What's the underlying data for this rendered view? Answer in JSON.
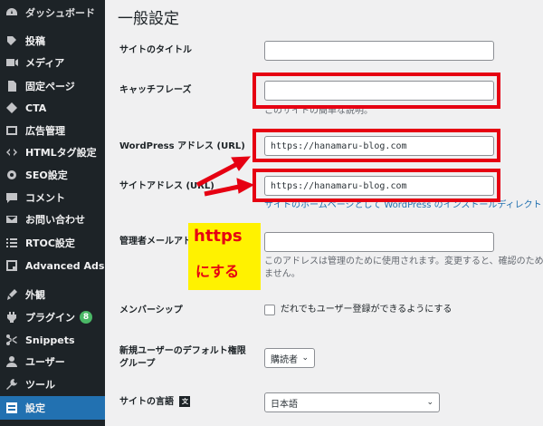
{
  "sidebar": {
    "items": [
      {
        "label": "ダッシュボード",
        "icon": "dashboard-icon"
      },
      {
        "label": "投稿",
        "icon": "pin-icon"
      },
      {
        "label": "メディア",
        "icon": "media-icon"
      },
      {
        "label": "固定ページ",
        "icon": "page-icon"
      },
      {
        "label": "CTA",
        "icon": "tag-icon"
      },
      {
        "label": "広告管理",
        "icon": "ad-icon"
      },
      {
        "label": "HTMLタグ設定",
        "icon": "code-icon"
      },
      {
        "label": "SEO設定",
        "icon": "gear-icon"
      },
      {
        "label": "コメント",
        "icon": "comment-icon"
      },
      {
        "label": "お問い合わせ",
        "icon": "mail-icon"
      },
      {
        "label": "RTOC設定",
        "icon": "list-icon"
      },
      {
        "label": "Advanced Ads",
        "icon": "ads-icon"
      },
      {
        "label": "外観",
        "icon": "brush-icon"
      },
      {
        "label": "プラグイン",
        "icon": "plugin-icon",
        "badge": "8"
      },
      {
        "label": "Snippets",
        "icon": "scissors-icon"
      },
      {
        "label": "ユーザー",
        "icon": "user-icon"
      },
      {
        "label": "ツール",
        "icon": "wrench-icon"
      },
      {
        "label": "設定",
        "icon": "settings-icon"
      }
    ]
  },
  "page": {
    "title": "一般設定",
    "site_title_label": "サイトのタイトル",
    "site_title_value": "",
    "tagline_label": "キャッチフレーズ",
    "tagline_value": "",
    "tagline_desc": "このサイトの簡単な説明。",
    "wp_address_label": "WordPress アドレス (URL)",
    "wp_address_value": "https://hanamaru-blog.com",
    "site_address_label": "サイトアドレス (URL)",
    "site_address_value": "https://hanamaru-blog.com",
    "site_address_desc": "サイトのホームページとして WordPress のインストールディレクト",
    "admin_email_label": "管理者メールアドレス",
    "admin_email_value": "",
    "admin_email_desc1": "このアドレスは管理のために使用されます。変更すると、確認のため",
    "admin_email_desc2": "ません。",
    "membership_label": "メンバーシップ",
    "membership_option": "だれでもユーザー登録ができるようにする",
    "default_role_label1": "新規ユーザーのデフォルト権限",
    "default_role_label2": "グループ",
    "default_role_value": "購読者",
    "language_label": "サイトの言語",
    "language_value": "日本語"
  },
  "annotation": {
    "line1": "https",
    "line2": "にする",
    "color": "#e60012",
    "bubble_color": "#fff200"
  }
}
